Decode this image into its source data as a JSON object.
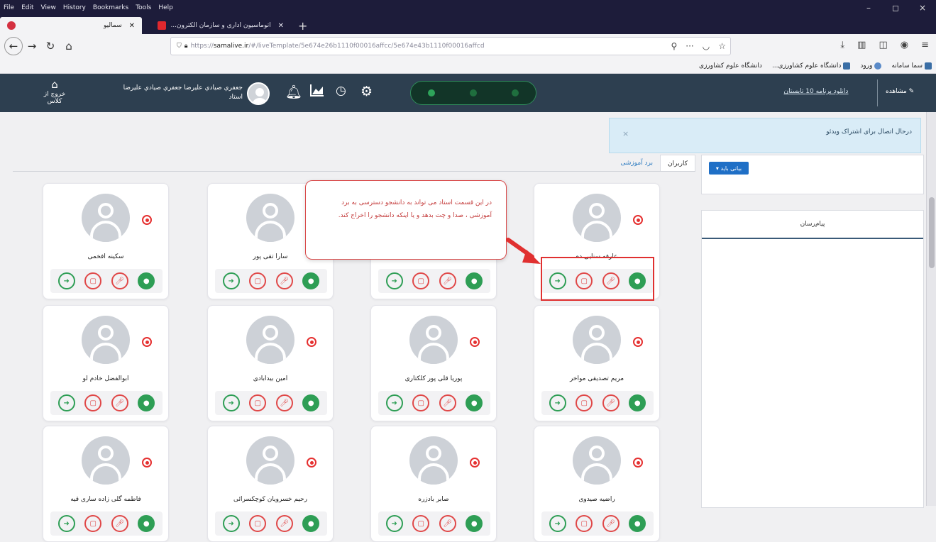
{
  "menubar": {
    "items": [
      "File",
      "Edit",
      "View",
      "History",
      "Bookmarks",
      "Tools",
      "Help"
    ],
    "win_ctrls": [
      "–",
      "◻",
      "×"
    ]
  },
  "tabs": [
    {
      "label": "سماليو",
      "active": true
    },
    {
      "label": "اتوماسیون اداری و سازمان الکترون...",
      "active": false
    }
  ],
  "navbar": {
    "url_prefix": "https://",
    "url_host": "samalive.ir",
    "url_rest": "/#/liveTemplate/5e674e26b1110f00016affcc/5e674e43b1110f00016affcd"
  },
  "bookmarks": [
    {
      "label": "سما سامانه"
    },
    {
      "label": "ورود"
    },
    {
      "label": "دانشگاه علوم کشاورزی..."
    },
    {
      "label": "دانشگاه علوم کشاورزی"
    }
  ],
  "header": {
    "exit_label": "خروج از کلاس",
    "user_name": "جعفري صیادي علیرضا جعفري صیادي علیرضا",
    "user_role": "استاد",
    "class_title": "دانلود برنامه 10 تابستان",
    "right_label": "مشاهده"
  },
  "toast": {
    "message": "درحال اتصال برای اشتراک ویدئو",
    "close": "×"
  },
  "content_tabs": [
    {
      "label": "کاربران",
      "active": true
    },
    {
      "label": "برد آموزشی",
      "active": false
    }
  ],
  "panel": {
    "upload_label": "بیانی باید ▾",
    "messages_title": "پیام‌رسان"
  },
  "callout": {
    "text": "در این قسمت استاد می تواند به دانشجو دسترسی به برد آموزشی ، صدا و چت بدهد و یا اینکه دانشجو را اخراج کند."
  },
  "users": [
    {
      "name": "سکینه افخمی"
    },
    {
      "name": "سارا تقی پور"
    },
    {
      "name": ""
    },
    {
      "name": "عارفه سنایی ده"
    },
    {
      "name": "ابوالفضل خادم لو"
    },
    {
      "name": "امین بیدابادی"
    },
    {
      "name": "پوریا قلی پور کلکتاری"
    },
    {
      "name": "مریم تصدیقی مواخر"
    },
    {
      "name": "فاطمه گلی زاده ساری قیه"
    },
    {
      "name": "رحیم خسرویان کوچکسرائی"
    },
    {
      "name": "صابر بادزره"
    },
    {
      "name": "راضیه صیدوی"
    }
  ],
  "colors": {
    "header_bg": "#2d3f50",
    "accent_green": "#2e9e55",
    "accent_red": "#e04848",
    "toast_bg": "#d9ecf7",
    "browser_dark": "#1d1c3a"
  }
}
